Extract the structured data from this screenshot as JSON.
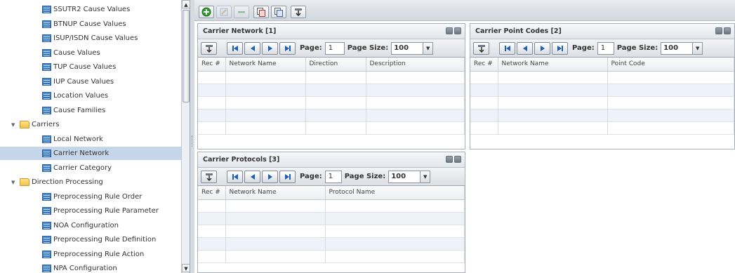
{
  "tree": {
    "items": [
      {
        "label": "SSUTR2 Cause Values",
        "level": 1,
        "icon": "document-icon"
      },
      {
        "label": "BTNUP Cause Values",
        "level": 1,
        "icon": "document-icon"
      },
      {
        "label": "ISUP/ISDN Cause Values",
        "level": 1,
        "icon": "document-icon"
      },
      {
        "label": "Cause Values",
        "level": 1,
        "icon": "document-icon"
      },
      {
        "label": "TUP Cause Values",
        "level": 1,
        "icon": "document-icon"
      },
      {
        "label": "IUP Cause Values",
        "level": 1,
        "icon": "document-icon"
      },
      {
        "label": "Location Values",
        "level": 1,
        "icon": "document-icon"
      },
      {
        "label": "Cause Families",
        "level": 1,
        "icon": "document-icon"
      },
      {
        "label": "Carriers",
        "level": 0,
        "icon": "folder-icon"
      },
      {
        "label": "Local Network",
        "level": 1,
        "icon": "document-icon"
      },
      {
        "label": "Carrier Network",
        "level": 1,
        "icon": "document-icon",
        "selected": true
      },
      {
        "label": "Carrier Category",
        "level": 1,
        "icon": "document-icon"
      },
      {
        "label": "Direction Processing",
        "level": 0,
        "icon": "folder-icon"
      },
      {
        "label": "Preprocessing Rule Order",
        "level": 1,
        "icon": "document-icon"
      },
      {
        "label": "Preprocessing Rule Parameter",
        "level": 1,
        "icon": "document-icon"
      },
      {
        "label": "NOA Configuration",
        "level": 1,
        "icon": "document-icon"
      },
      {
        "label": "Preprocessing Rule Definition",
        "level": 1,
        "icon": "document-icon"
      },
      {
        "label": "Preprocessing Rule Action",
        "level": 1,
        "icon": "document-icon"
      },
      {
        "label": "NPA Configuration",
        "level": 1,
        "icon": "document-icon"
      }
    ]
  },
  "toolbar": {
    "buttons": [
      "add-icon",
      "edit-icon",
      "delete-icon",
      "copy-icon",
      "paste-icon",
      "export-icon"
    ]
  },
  "panels": {
    "carrier_network": {
      "title": "Carrier Network [1]",
      "page_label": "Page:",
      "page_value": "1",
      "page_size_label": "Page Size:",
      "page_size_value": "100",
      "columns": [
        "Rec #",
        "Network Name",
        "Direction",
        "Description"
      ],
      "rows": 5
    },
    "carrier_point_codes": {
      "title": "Carrier Point Codes [2]",
      "page_label": "Page:",
      "page_value": "1",
      "page_size_label": "Page Size:",
      "page_size_value": "100",
      "columns": [
        "Rec #",
        "Network Name",
        "Point Code"
      ],
      "rows": 5
    },
    "carrier_protocols": {
      "title": "Carrier Protocols [3]",
      "page_label": "Page:",
      "page_value": "1",
      "page_size_label": "Page Size:",
      "page_size_value": "100",
      "columns": [
        "Rec #",
        "Network Name",
        "Protocol Name"
      ],
      "rows": 5
    }
  },
  "colors": {
    "selected_row": "#c5d5ea",
    "nav_arrow": "#1f5fb0",
    "add_green": "#2f9d2f"
  }
}
